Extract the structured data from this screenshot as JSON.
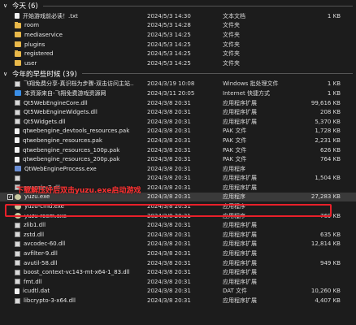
{
  "groups": [
    {
      "title": "今天 (6)",
      "rows": [
        {
          "name": "开始游戏前必读！.txt",
          "date": "2024/5/3 14:30",
          "type": "文本文档",
          "size": "1 KB",
          "icon": "file-icon"
        },
        {
          "name": "room",
          "date": "2024/5/3 14:28",
          "type": "文件夹",
          "size": "",
          "icon": "folder-icon"
        },
        {
          "name": "mediaservice",
          "date": "2024/5/3 14:25",
          "type": "文件夹",
          "size": "",
          "icon": "folder-icon"
        },
        {
          "name": "plugins",
          "date": "2024/5/3 14:25",
          "type": "文件夹",
          "size": "",
          "icon": "folder-icon"
        },
        {
          "name": "registered",
          "date": "2024/5/3 14:25",
          "type": "文件夹",
          "size": "",
          "icon": "folder-icon"
        },
        {
          "name": "user",
          "date": "2024/5/3 14:25",
          "type": "文件夹",
          "size": "",
          "icon": "folder-icon"
        }
      ]
    },
    {
      "title": "今年的早些时候 (39)",
      "rows": [
        {
          "name": "飞翔免费分享-真识档为步骤-双击访问主站...",
          "date": "2024/3/19 10:08",
          "type": "Windows 批处理文件",
          "size": "1 KB",
          "icon": "batch-file-icon"
        },
        {
          "name": "本资源来自-飞翔免费游戏资源网",
          "date": "2024/3/11 20:05",
          "type": "Internet 快捷方式",
          "size": "1 KB",
          "icon": "internet-shortcut-icon"
        },
        {
          "name": "Qt5WebEngineCore.dll",
          "date": "2024/3/8 20:31",
          "type": "应用程序扩展",
          "size": "99,616 KB",
          "icon": "dll-icon"
        },
        {
          "name": "Qt5WebEngineWidgets.dll",
          "date": "2024/3/8 20:31",
          "type": "应用程序扩展",
          "size": "208 KB",
          "icon": "dll-icon"
        },
        {
          "name": "Qt5Widgets.dll",
          "date": "2024/3/8 20:31",
          "type": "应用程序扩展",
          "size": "5,370 KB",
          "icon": "dll-icon"
        },
        {
          "name": "qtwebengine_devtools_resources.pak",
          "date": "2024/3/8 20:31",
          "type": "PAK 文件",
          "size": "1,728 KB",
          "icon": "pak-file-icon"
        },
        {
          "name": "qtwebengine_resources.pak",
          "date": "2024/3/8 20:31",
          "type": "PAK 文件",
          "size": "2,231 KB",
          "icon": "pak-file-icon"
        },
        {
          "name": "qtwebengine_resources_100p.pak",
          "date": "2024/3/8 20:31",
          "type": "PAK 文件",
          "size": "626 KB",
          "icon": "pak-file-icon"
        },
        {
          "name": "qtwebengine_resources_200p.pak",
          "date": "2024/3/8 20:31",
          "type": "PAK 文件",
          "size": "764 KB",
          "icon": "pak-file-icon"
        },
        {
          "name": "QtWebEngineProcess.exe",
          "date": "2024/3/8 20:31",
          "type": "应用程序",
          "size": "",
          "icon": "exe-icon"
        },
        {
          "name": "",
          "date": "2024/3/8 20:31",
          "type": "应用程序扩展",
          "size": "1,504 KB",
          "icon": "dll-icon"
        },
        {
          "name": "swscale-7.dll",
          "date": "2024/3/8 20:31",
          "type": "应用程序扩展",
          "size": "",
          "icon": "dll-icon"
        },
        {
          "name": "yuzu.exe",
          "date": "2024/3/8 20:31",
          "type": "应用程序",
          "size": "27,283 KB",
          "icon": "yuzu-app-icon",
          "selected": true
        },
        {
          "name": "yuzu-cmd.exe",
          "date": "2024/3/8 20:31",
          "type": "应用程序",
          "size": "",
          "icon": "yuzu-app-icon"
        },
        {
          "name": "yuzu-room.exe",
          "date": "2024/3/8 20:31",
          "type": "应用程序",
          "size": "769 KB",
          "icon": "yuzu-app-icon"
        },
        {
          "name": "zlib1.dll",
          "date": "2024/3/8 20:31",
          "type": "应用程序扩展",
          "size": "",
          "icon": "dll-icon"
        },
        {
          "name": "zstd.dll",
          "date": "2024/3/8 20:31",
          "type": "应用程序扩展",
          "size": "635 KB",
          "icon": "dll-icon"
        },
        {
          "name": "avcodec-60.dll",
          "date": "2024/3/8 20:31",
          "type": "应用程序扩展",
          "size": "12,814 KB",
          "icon": "dll-icon"
        },
        {
          "name": "avfilter-9.dll",
          "date": "2024/3/8 20:31",
          "type": "应用程序扩展",
          "size": "",
          "icon": "dll-icon"
        },
        {
          "name": "avutil-58.dll",
          "date": "2024/3/8 20:31",
          "type": "应用程序扩展",
          "size": "949 KB",
          "icon": "dll-icon"
        },
        {
          "name": "boost_context-vc143-mt-x64-1_83.dll",
          "date": "2024/3/8 20:31",
          "type": "应用程序扩展",
          "size": "",
          "icon": "dll-icon"
        },
        {
          "name": "fmt.dll",
          "date": "2024/3/8 20:31",
          "type": "应用程序扩展",
          "size": "",
          "icon": "dll-icon"
        },
        {
          "name": "icudtl.dat",
          "date": "2024/3/8 20:31",
          "type": "DAT 文件",
          "size": "10,260 KB",
          "icon": "dat-file-icon"
        },
        {
          "name": "libcrypto-3-x64.dll",
          "date": "2024/3/8 20:31",
          "type": "应用程序扩展",
          "size": "4,407 KB",
          "icon": "dll-icon"
        }
      ]
    }
  ],
  "annotation": "下载解压好后双击yuzu.exe启动游戏",
  "colors": {
    "accent_red": "#e8202a",
    "background": "#1c1c1c",
    "folder": "#e8b84a"
  }
}
